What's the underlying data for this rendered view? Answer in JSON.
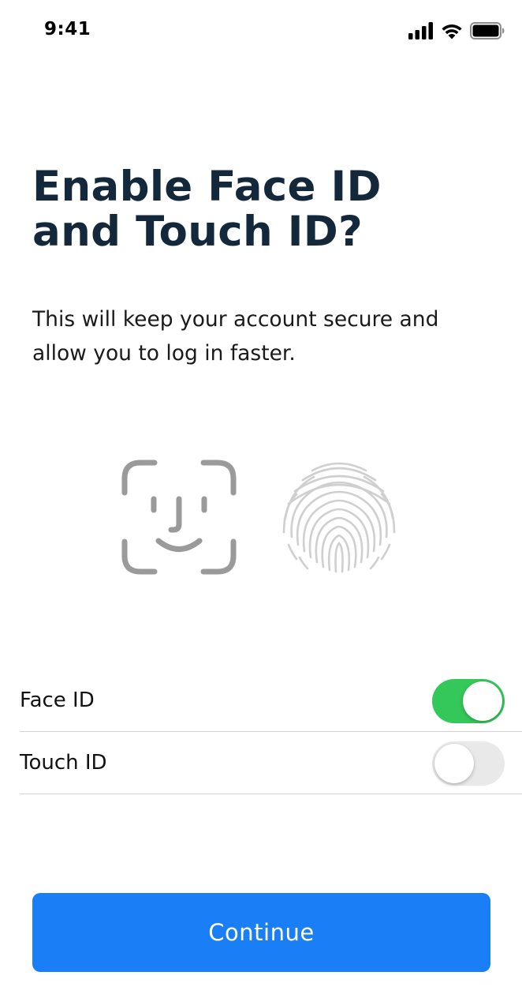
{
  "status_bar": {
    "time": "9:41",
    "icons": [
      "cellular-signal-icon",
      "wifi-icon",
      "battery-icon"
    ]
  },
  "header": {
    "title_line1": "Enable Face ID",
    "title_line2": "and Touch ID?",
    "subtitle_line1": "This will keep your account secure and",
    "subtitle_line2": "allow you to log in faster."
  },
  "illustrations": [
    "face-id-icon",
    "touch-id-icon"
  ],
  "settings": {
    "items": [
      {
        "label": "Face ID",
        "enabled": true
      },
      {
        "label": "Touch ID",
        "enabled": false
      }
    ]
  },
  "actions": {
    "continue_label": "Continue"
  },
  "colors": {
    "title": "#14283c",
    "accent": "#1a7ef6",
    "toggle_on": "#34c759",
    "toggle_off": "#e9e9ea",
    "icon_gray": "#9a9a9a"
  }
}
